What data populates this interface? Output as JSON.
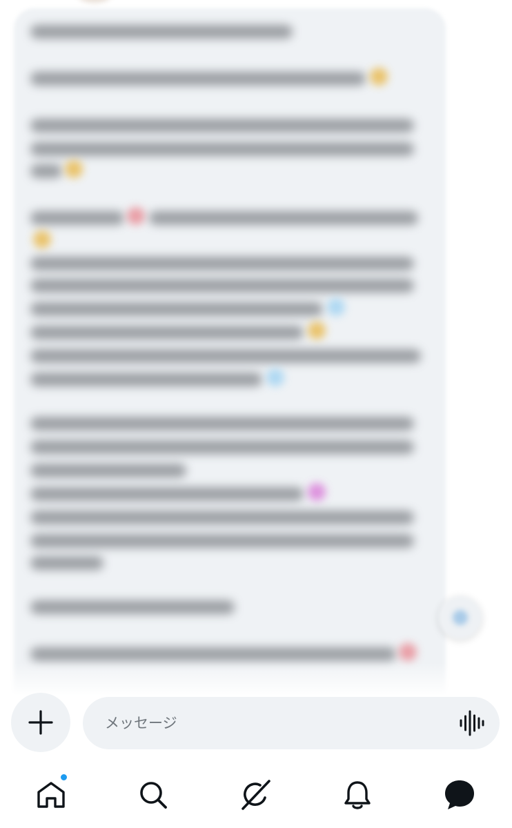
{
  "composer": {
    "placeholder": "メッセージ",
    "add_icon": "plus-icon",
    "voice_icon": "waveform-icon"
  },
  "bottom_nav": {
    "items": [
      {
        "icon": "home-icon",
        "has_badge": true
      },
      {
        "icon": "search-icon",
        "has_badge": false
      },
      {
        "icon": "grok-icon",
        "has_badge": false
      },
      {
        "icon": "bell-icon",
        "has_badge": false
      },
      {
        "icon": "messages-icon",
        "has_badge": false,
        "active": true
      }
    ]
  },
  "message": {
    "content_state": "blurred"
  },
  "colors": {
    "bubble": "#eff2f5",
    "icon": "#0f1419",
    "badge": "#1d9bf0",
    "placeholder": "#6f767c"
  }
}
